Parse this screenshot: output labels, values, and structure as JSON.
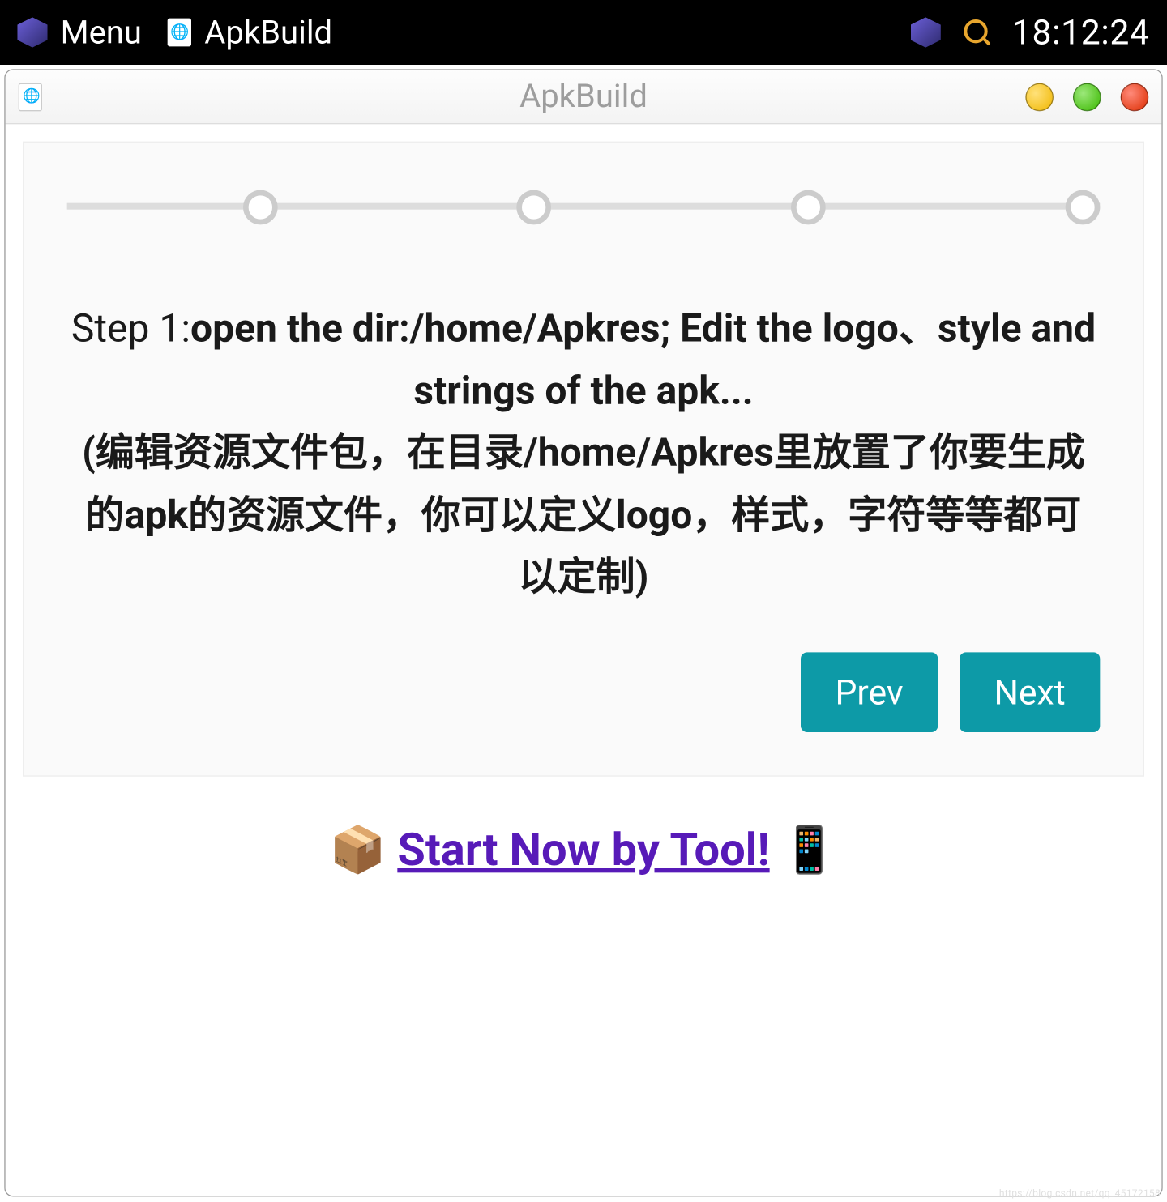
{
  "taskbar": {
    "menu_label": "Menu",
    "app_label": "ApkBuild",
    "clock": "18:12:24"
  },
  "window": {
    "title": "ApkBuild"
  },
  "step": {
    "prefix": "Step 1:",
    "headline": "open the dir:/home/Apkres; Edit the logo、style and strings of the apk...",
    "subline": "(编辑资源文件包，在目录/home/Apkres里放置了你要生成的apk的资源文件，你可以定义logo，样式，字符等等都可以定制)",
    "prev_label": "Prev",
    "next_label": "Next",
    "current_index": 0,
    "total_steps": 4
  },
  "cta": {
    "leading_emoji": "📦",
    "text": "Start Now by Tool!",
    "trailing_emoji": "📱"
  },
  "watermark": "https://blog.csdn.net/qq_45172158"
}
